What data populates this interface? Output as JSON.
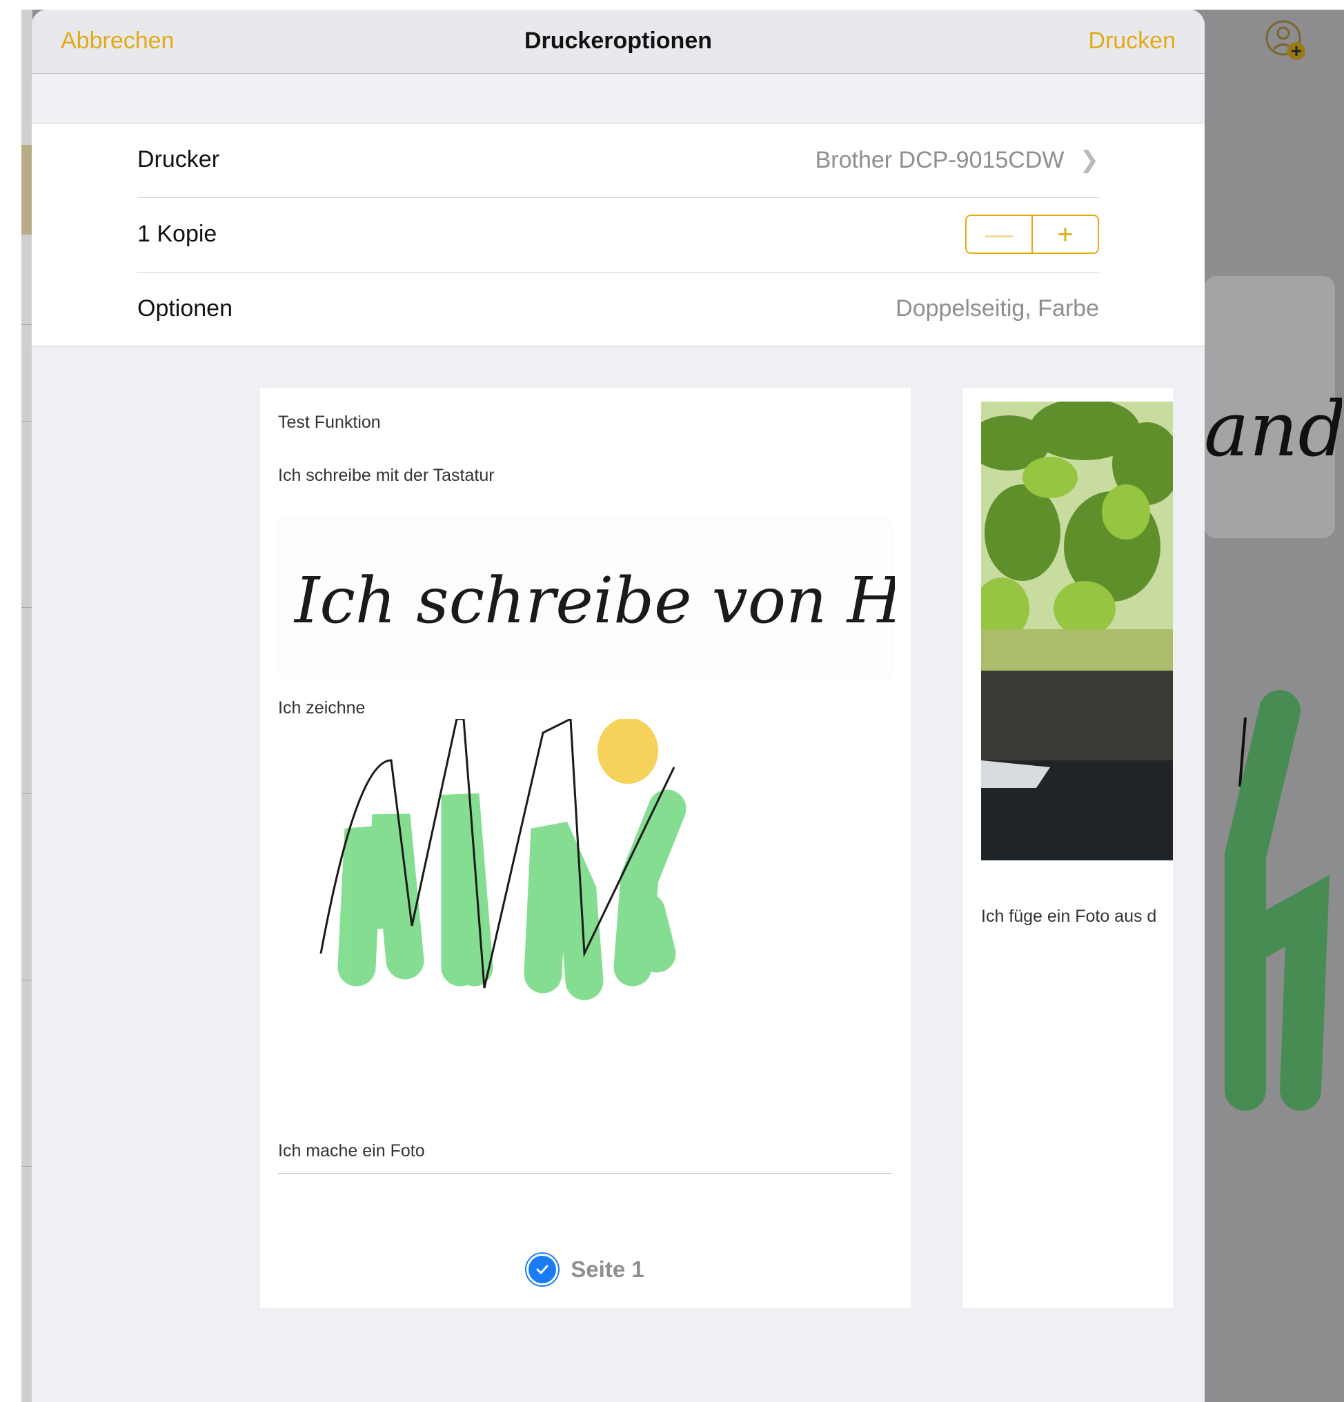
{
  "navbar": {
    "cancel_label": "Abbrechen",
    "title": "Druckeroptionen",
    "print_label": "Drucken"
  },
  "settings": {
    "printer_label": "Drucker",
    "printer_value": "Brother DCP-9015CDW",
    "copies_label": "1 Kopie",
    "stepper_minus": "—",
    "stepper_plus": "+",
    "options_label": "Optionen",
    "options_value": "Doppelseitig, Farbe"
  },
  "preview": {
    "page1": {
      "title": "Test Funktion",
      "typed_line": "Ich schreibe mit der Tastatur",
      "handwriting": "Ich schreibe von Hand",
      "drawing_label": "Ich zeichne",
      "photo_label": "Ich mache ein Foto",
      "page_label": "Seite 1",
      "selected": true
    },
    "page2": {
      "caption": "Ich füge ein Foto aus d"
    }
  },
  "background": {
    "handwriting_fragment": "and"
  },
  "colors": {
    "accent": "#e2aa17",
    "checkbox": "#1a7cf5",
    "drawing_green": "#7fdc8c",
    "drawing_sun": "#f7d25a"
  },
  "icons": {
    "printer_chevron": "chevron-right-icon",
    "page_checkbox": "checkmark-circle-icon",
    "background_add_person": "add-person-icon"
  }
}
